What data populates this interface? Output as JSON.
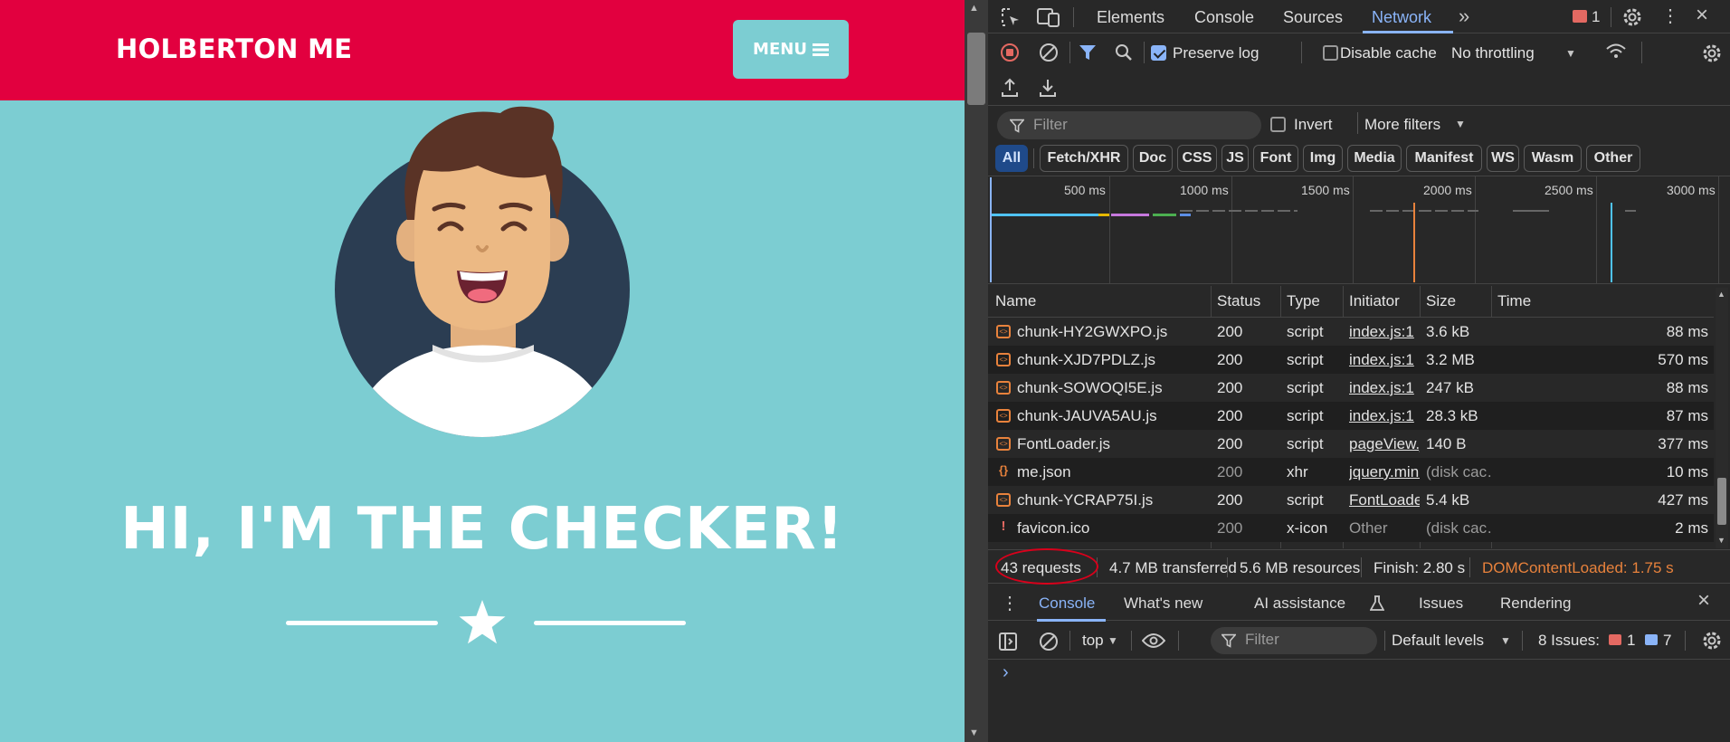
{
  "site": {
    "title": "HOLBERTON ME",
    "menu_label": "MENU",
    "hero_title": "HI, I'M THE CHECKER!",
    "colors": {
      "header": "#e2003f",
      "background": "#7ccdd2",
      "avatar_circle": "#2b3d52"
    }
  },
  "devtools": {
    "top_tabs": [
      "Elements",
      "Console",
      "Sources",
      "Network"
    ],
    "active_tab": "Network",
    "more_tabs_icon": "chevron-double-right-icon",
    "issues_badge_count": "1",
    "toolbar": {
      "preserve_log_label": "Preserve log",
      "preserve_log_checked": true,
      "disable_cache_label": "Disable cache",
      "disable_cache_checked": false,
      "throttling_value": "No throttling"
    },
    "filter": {
      "placeholder": "Filter",
      "invert_label": "Invert",
      "more_filters_label": "More filters"
    },
    "type_filters": [
      "All",
      "Fetch/XHR",
      "Doc",
      "CSS",
      "JS",
      "Font",
      "Img",
      "Media",
      "Manifest",
      "WS",
      "Wasm",
      "Other"
    ],
    "active_type_filter": "All",
    "timeline_ticks": [
      "500 ms",
      "1000 ms",
      "1500 ms",
      "2000 ms",
      "2500 ms",
      "3000 ms"
    ],
    "table": {
      "columns": [
        "Name",
        "Status",
        "Type",
        "Initiator",
        "Size",
        "Time"
      ],
      "rows": [
        {
          "name": "chunk-HY2GWXPO.js",
          "status": "200",
          "type": "script",
          "initiator": "index.js:1",
          "size": "3.6 kB",
          "time": "88 ms",
          "icon": "script-icon"
        },
        {
          "name": "chunk-XJD7PDLZ.js",
          "status": "200",
          "type": "script",
          "initiator": "index.js:1",
          "size": "3.2 MB",
          "time": "570 ms",
          "icon": "script-icon"
        },
        {
          "name": "chunk-SOWOQI5E.js",
          "status": "200",
          "type": "script",
          "initiator": "index.js:1",
          "size": "247 kB",
          "time": "88 ms",
          "icon": "script-icon"
        },
        {
          "name": "chunk-JAUVA5AU.js",
          "status": "200",
          "type": "script",
          "initiator": "index.js:1",
          "size": "28.3 kB",
          "time": "87 ms",
          "icon": "script-icon"
        },
        {
          "name": "FontLoader.js",
          "status": "200",
          "type": "script",
          "initiator": "pageView.js",
          "size": "140 B",
          "time": "377 ms",
          "icon": "script-icon"
        },
        {
          "name": "me.json",
          "status": "200",
          "type": "xhr",
          "initiator": "jquery.min.j",
          "size": "(disk cac…",
          "time": "10 ms",
          "icon": "json-icon"
        },
        {
          "name": "chunk-YCRAP75I.js",
          "status": "200",
          "type": "script",
          "initiator": "FontLoader.",
          "size": "5.4 kB",
          "time": "427 ms",
          "icon": "script-icon"
        },
        {
          "name": "favicon.ico",
          "status": "200",
          "type": "x-icon",
          "initiator": "Other",
          "size": "(disk cac…",
          "time": "2 ms",
          "icon": "error-icon"
        }
      ]
    },
    "status_bar": {
      "requests": "43 requests",
      "transferred": "4.7 MB transferred",
      "resources": "5.6 MB resources",
      "finish": "Finish: 2.80 s",
      "dom_content_loaded": "DOMContentLoaded: 1.75 s"
    },
    "drawer_tabs": [
      "Console",
      "What's new",
      "AI assistance",
      "Issues",
      "Rendering"
    ],
    "active_drawer_tab": "Console",
    "console_toolbar": {
      "context": "top",
      "filter_placeholder": "Filter",
      "levels": "Default levels",
      "issues_label": "8 Issues:",
      "issues_errors": "1",
      "issues_messages": "7"
    },
    "prompt_symbol": "›"
  }
}
